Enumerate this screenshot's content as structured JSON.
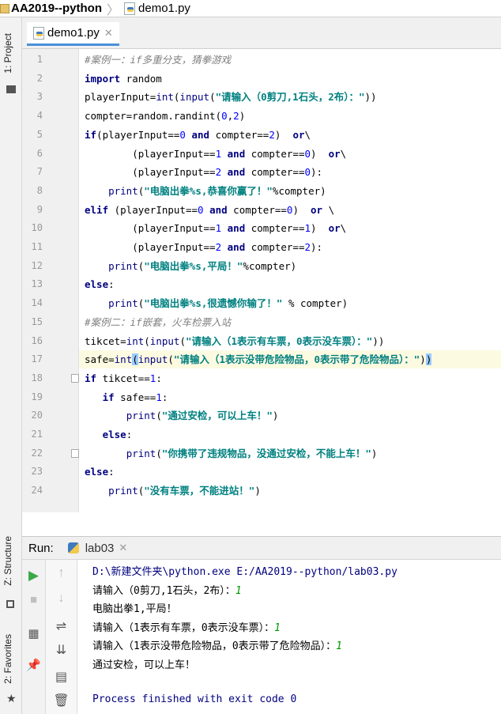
{
  "breadcrumb": {
    "project": "AA2019--python",
    "file": "demo1.py"
  },
  "left_strip": {
    "project": "1: Project",
    "structure": "Z: Structure",
    "favorites": "2: Favorites"
  },
  "editor": {
    "tab": "demo1.py",
    "lines": [
      {
        "no": "1",
        "segs": [
          {
            "c": "cm",
            "t": "#案例一：if多重分支，猜拳游戏"
          }
        ]
      },
      {
        "no": "2",
        "segs": [
          {
            "c": "kw",
            "t": "import"
          },
          {
            "c": "",
            "t": " random"
          }
        ]
      },
      {
        "no": "3",
        "segs": [
          {
            "c": "",
            "t": "playerInput="
          },
          {
            "c": "bi",
            "t": "int"
          },
          {
            "c": "",
            "t": "("
          },
          {
            "c": "bi",
            "t": "input"
          },
          {
            "c": "",
            "t": "("
          },
          {
            "c": "str",
            "t": "\"请输入（0剪刀,1石头，2布）：\""
          },
          {
            "c": "",
            "t": "))"
          }
        ]
      },
      {
        "no": "4",
        "segs": [
          {
            "c": "",
            "t": "compter=random.randint("
          },
          {
            "c": "num",
            "t": "0"
          },
          {
            "c": "",
            "t": ","
          },
          {
            "c": "num",
            "t": "2"
          },
          {
            "c": "",
            "t": ")"
          }
        ]
      },
      {
        "no": "5",
        "segs": [
          {
            "c": "kw",
            "t": "if"
          },
          {
            "c": "",
            "t": "(playerInput=="
          },
          {
            "c": "num",
            "t": "0"
          },
          {
            "c": "",
            "t": " "
          },
          {
            "c": "kw",
            "t": "and"
          },
          {
            "c": "",
            "t": " compter=="
          },
          {
            "c": "num",
            "t": "2"
          },
          {
            "c": "",
            "t": ")  "
          },
          {
            "c": "kw",
            "t": "or"
          },
          {
            "c": "",
            "t": "\\"
          }
        ]
      },
      {
        "no": "6",
        "segs": [
          {
            "c": "",
            "t": "        (playerInput=="
          },
          {
            "c": "num",
            "t": "1"
          },
          {
            "c": "",
            "t": " "
          },
          {
            "c": "kw",
            "t": "and"
          },
          {
            "c": "",
            "t": " compter=="
          },
          {
            "c": "num",
            "t": "0"
          },
          {
            "c": "",
            "t": ")  "
          },
          {
            "c": "kw",
            "t": "or"
          },
          {
            "c": "",
            "t": "\\"
          }
        ]
      },
      {
        "no": "7",
        "segs": [
          {
            "c": "",
            "t": "        (playerInput=="
          },
          {
            "c": "num",
            "t": "2"
          },
          {
            "c": "",
            "t": " "
          },
          {
            "c": "kw",
            "t": "and"
          },
          {
            "c": "",
            "t": " compter=="
          },
          {
            "c": "num",
            "t": "0"
          },
          {
            "c": "",
            "t": "):"
          }
        ]
      },
      {
        "no": "8",
        "segs": [
          {
            "c": "",
            "t": "    "
          },
          {
            "c": "bi",
            "t": "print"
          },
          {
            "c": "",
            "t": "("
          },
          {
            "c": "str",
            "t": "\"电脑出拳%s,恭喜你赢了！\""
          },
          {
            "c": "",
            "t": "%compter)"
          }
        ]
      },
      {
        "no": "9",
        "segs": [
          {
            "c": "kw",
            "t": "elif"
          },
          {
            "c": "",
            "t": " (playerInput=="
          },
          {
            "c": "num",
            "t": "0"
          },
          {
            "c": "",
            "t": " "
          },
          {
            "c": "kw",
            "t": "and"
          },
          {
            "c": "",
            "t": " compter=="
          },
          {
            "c": "num",
            "t": "0"
          },
          {
            "c": "",
            "t": ")  "
          },
          {
            "c": "kw",
            "t": "or"
          },
          {
            "c": "",
            "t": " \\"
          }
        ]
      },
      {
        "no": "10",
        "segs": [
          {
            "c": "",
            "t": "        (playerInput=="
          },
          {
            "c": "num",
            "t": "1"
          },
          {
            "c": "",
            "t": " "
          },
          {
            "c": "kw",
            "t": "and"
          },
          {
            "c": "",
            "t": " compter=="
          },
          {
            "c": "num",
            "t": "1"
          },
          {
            "c": "",
            "t": ")  "
          },
          {
            "c": "kw",
            "t": "or"
          },
          {
            "c": "",
            "t": "\\"
          }
        ]
      },
      {
        "no": "11",
        "segs": [
          {
            "c": "",
            "t": "        (playerInput=="
          },
          {
            "c": "num",
            "t": "2"
          },
          {
            "c": "",
            "t": " "
          },
          {
            "c": "kw",
            "t": "and"
          },
          {
            "c": "",
            "t": " compter=="
          },
          {
            "c": "num",
            "t": "2"
          },
          {
            "c": "",
            "t": "):"
          }
        ]
      },
      {
        "no": "12",
        "segs": [
          {
            "c": "",
            "t": "    "
          },
          {
            "c": "bi",
            "t": "print"
          },
          {
            "c": "",
            "t": "("
          },
          {
            "c": "str",
            "t": "\"电脑出拳%s,平局！\""
          },
          {
            "c": "",
            "t": "%compter)"
          }
        ]
      },
      {
        "no": "13",
        "segs": [
          {
            "c": "kw",
            "t": "else"
          },
          {
            "c": "",
            "t": ":"
          }
        ]
      },
      {
        "no": "14",
        "segs": [
          {
            "c": "",
            "t": "    "
          },
          {
            "c": "bi",
            "t": "print"
          },
          {
            "c": "",
            "t": "("
          },
          {
            "c": "str",
            "t": "\"电脑出拳%s,很遗憾你输了！\""
          },
          {
            "c": "",
            "t": " % compter)"
          }
        ]
      },
      {
        "no": "15",
        "segs": [
          {
            "c": "cm",
            "t": "#案例二：if嵌套，火车检票入站"
          }
        ]
      },
      {
        "no": "16",
        "segs": [
          {
            "c": "",
            "t": "tikcet="
          },
          {
            "c": "bi",
            "t": "int"
          },
          {
            "c": "",
            "t": "("
          },
          {
            "c": "bi",
            "t": "input"
          },
          {
            "c": "",
            "t": "("
          },
          {
            "c": "str",
            "t": "\"请输入（1表示有车票，0表示没车票）：\""
          },
          {
            "c": "",
            "t": "))"
          }
        ]
      },
      {
        "no": "17",
        "segs": [
          {
            "c": "",
            "t": "safe="
          },
          {
            "c": "bi",
            "t": "int"
          },
          {
            "c": "brace-hl",
            "t": "("
          },
          {
            "c": "bi",
            "t": "input"
          },
          {
            "c": "",
            "t": "("
          },
          {
            "c": "str",
            "t": "\"请输入（1表示没带危险物品，0表示带了危险物品）：\""
          },
          {
            "c": "",
            "t": ")"
          },
          {
            "c": "brace-hl",
            "t": ")"
          }
        ]
      },
      {
        "no": "18",
        "segs": [
          {
            "c": "kw",
            "t": "if"
          },
          {
            "c": "",
            "t": " tikcet=="
          },
          {
            "c": "num",
            "t": "1"
          },
          {
            "c": "",
            "t": ":"
          }
        ]
      },
      {
        "no": "19",
        "segs": [
          {
            "c": "",
            "t": "   "
          },
          {
            "c": "kw",
            "t": "if"
          },
          {
            "c": "",
            "t": " safe=="
          },
          {
            "c": "num",
            "t": "1"
          },
          {
            "c": "",
            "t": ":"
          }
        ]
      },
      {
        "no": "20",
        "segs": [
          {
            "c": "",
            "t": "       "
          },
          {
            "c": "bi",
            "t": "print"
          },
          {
            "c": "",
            "t": "("
          },
          {
            "c": "str",
            "t": "\"通过安检，可以上车！\""
          },
          {
            "c": "",
            "t": ")"
          }
        ]
      },
      {
        "no": "21",
        "segs": [
          {
            "c": "",
            "t": "   "
          },
          {
            "c": "kw",
            "t": "else"
          },
          {
            "c": "",
            "t": ":"
          }
        ]
      },
      {
        "no": "22",
        "segs": [
          {
            "c": "",
            "t": "       "
          },
          {
            "c": "bi",
            "t": "print"
          },
          {
            "c": "",
            "t": "("
          },
          {
            "c": "str",
            "t": "\"你携带了违规物品，没通过安检，不能上车！\""
          },
          {
            "c": "",
            "t": ")"
          }
        ]
      },
      {
        "no": "23",
        "segs": [
          {
            "c": "kw",
            "t": "else"
          },
          {
            "c": "",
            "t": ":"
          }
        ]
      },
      {
        "no": "24",
        "segs": [
          {
            "c": "",
            "t": "    "
          },
          {
            "c": "bi",
            "t": "print"
          },
          {
            "c": "",
            "t": "("
          },
          {
            "c": "str",
            "t": "\"没有车票，不能进站！\""
          },
          {
            "c": "",
            "t": ")"
          }
        ]
      }
    ],
    "current_line": "17"
  },
  "run": {
    "label": "Run:",
    "tab": "lab03",
    "console": [
      {
        "parts": [
          {
            "c": "out-path",
            "t": "D:\\新建文件夹\\python.exe E:/AA2019--python/lab03.py"
          }
        ]
      },
      {
        "parts": [
          {
            "c": "",
            "t": "请输入（0剪刀,1石头，2布）："
          },
          {
            "c": "out-inp",
            "t": "1"
          }
        ]
      },
      {
        "parts": [
          {
            "c": "",
            "t": "电脑出拳1,平局！"
          }
        ]
      },
      {
        "parts": [
          {
            "c": "",
            "t": "请输入（1表示有车票，0表示没车票）："
          },
          {
            "c": "out-inp",
            "t": "1"
          }
        ]
      },
      {
        "parts": [
          {
            "c": "",
            "t": "请输入（1表示没带危险物品，0表示带了危险物品）："
          },
          {
            "c": "out-inp",
            "t": "1"
          }
        ]
      },
      {
        "parts": [
          {
            "c": "",
            "t": "通过安检，可以上车！"
          }
        ]
      },
      {
        "parts": [
          {
            "c": "",
            "t": ""
          }
        ]
      },
      {
        "parts": [
          {
            "c": "out-done",
            "t": "Process finished with exit code 0"
          }
        ]
      }
    ]
  },
  "colors": {
    "keyword": "#000080",
    "string": "#008080",
    "number": "#0000ff",
    "comment": "#808080",
    "current_line": "#fcfae1"
  }
}
